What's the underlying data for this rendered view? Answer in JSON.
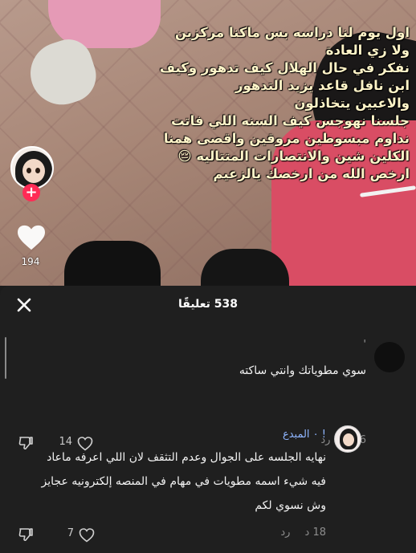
{
  "video": {
    "caption_lines": [
      "اول يوم لنا دراسه بس ماكنا مركزين",
      "ولا زي العادة",
      "نفكر في حال الهلال كيف تدهور وكيف",
      "ابن نافل قاعد يزيد التدهور",
      "والاعبين يتخاذلون",
      "جلسنا نهوجس كيف السنه اللي فاتت",
      "نداوم مبسوطين مروقين واقصى همنا",
      "الكلين شين والانتصارات المتتاليه 😔",
      "ارخص الله من ارخصك يالزعيم"
    ],
    "follow_label": "+",
    "like_count": "194"
  },
  "comments_sheet": {
    "count_label": "538 تعليقًا",
    "comments": [
      {
        "name": "'",
        "text_lines": [
          "سوي مطوياتك وانتي ساكته"
        ],
        "time": "56 د",
        "reply_label": "رد",
        "likes": "14"
      },
      {
        "name": "! ٠ المبدع",
        "text_lines": [
          "نهايه الجلسه على الجوال وعدم التثقف لان اللي اعرفه ماعاد",
          "فيه شيء اسمه مطويات في مهام في المنصه إلكترونيه عجايز",
          "وش نسوي لكم"
        ],
        "time": "18 د",
        "reply_label": "رد",
        "likes": "7"
      }
    ]
  },
  "icons": [
    "close-icon",
    "heart-icon",
    "dislike-icon",
    "avatar-icon"
  ],
  "colors": {
    "sheet_bg": "#1f1f1f",
    "follow_red": "#ff2b55",
    "caption_yellow": "#fff4c8"
  }
}
